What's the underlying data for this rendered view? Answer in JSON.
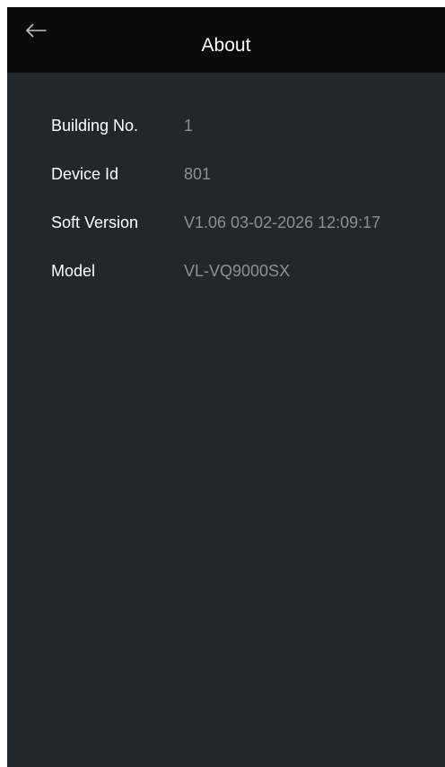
{
  "header": {
    "title": "About",
    "back_icon": "arrow-left-icon"
  },
  "info": [
    {
      "label": "Building No.",
      "value": "1"
    },
    {
      "label": "Device Id",
      "value": "801"
    },
    {
      "label": "Soft Version",
      "value": "V1.06 03-02-2026 12:09:17"
    },
    {
      "label": "Model",
      "value": "VL-VQ9000SX"
    }
  ],
  "colors": {
    "header_bg": "#0a0a0b",
    "body_bg": "#22262d",
    "label_text": "#ffffff",
    "value_text": "#8d9095"
  }
}
